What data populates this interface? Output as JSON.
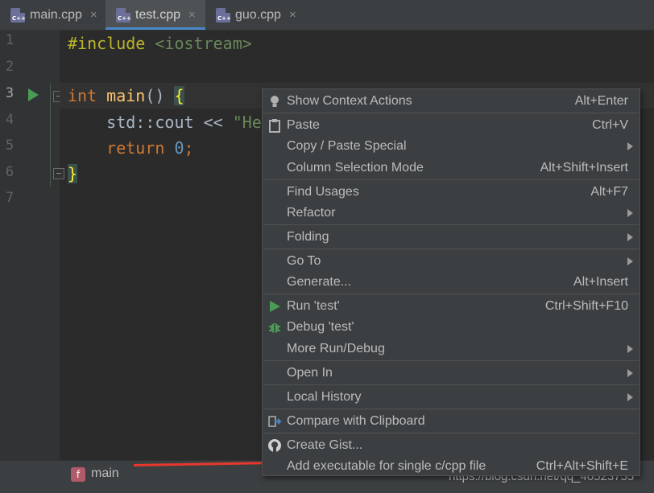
{
  "tabs": [
    {
      "label": "main.cpp",
      "close": "×",
      "icon": "cpp-file-icon"
    },
    {
      "label": "test.cpp",
      "close": "×",
      "icon": "cpp-file-icon",
      "active": true
    },
    {
      "label": "guo.cpp",
      "close": "×",
      "icon": "cpp-file-icon"
    }
  ],
  "file_icon_text": "C++",
  "line_numbers": [
    "1",
    "2",
    "3",
    "4",
    "5",
    "6",
    "7"
  ],
  "current_line": "3",
  "code": {
    "l1_directive": "#include",
    "l1_header": "<iostream>",
    "l3_type": "int",
    "l3_fn": "main",
    "l3_parens": "()",
    "l3_brace": "{",
    "l4_indent": "    ",
    "l4_ns": "std::cout",
    "l4_op": " << ",
    "l4_str": "\"He",
    "l5_kw": "return",
    "l5_num": "0",
    "l5_semi": ";",
    "l6_brace": "}"
  },
  "context_menu": {
    "items": [
      {
        "label": "Show Context Actions",
        "shortcut": "Alt+Enter",
        "icon": "lightbulb-icon"
      },
      {
        "label": "Paste",
        "shortcut": "Ctrl+V",
        "icon": "clipboard-icon"
      },
      {
        "label": "Copy / Paste Special",
        "submenu": true
      },
      {
        "label": "Column Selection Mode",
        "shortcut": "Alt+Shift+Insert"
      },
      {
        "label": "Find Usages",
        "shortcut": "Alt+F7"
      },
      {
        "label": "Refactor",
        "submenu": true
      },
      {
        "label": "Folding",
        "submenu": true
      },
      {
        "label": "Go To",
        "submenu": true
      },
      {
        "label": "Generate...",
        "shortcut": "Alt+Insert"
      },
      {
        "label": "Run 'test'",
        "shortcut": "Ctrl+Shift+F10",
        "icon": "run-icon"
      },
      {
        "label": "Debug 'test'",
        "icon": "debug-bug-icon"
      },
      {
        "label": "More Run/Debug",
        "submenu": true
      },
      {
        "label": "Open In",
        "submenu": true
      },
      {
        "label": "Local History",
        "submenu": true
      },
      {
        "label": "Compare with Clipboard",
        "icon": "compare-icon"
      },
      {
        "label": "Create Gist...",
        "icon": "github-icon"
      },
      {
        "label": "Add executable for single c/cpp file",
        "shortcut": "Ctrl+Alt+Shift+E"
      }
    ]
  },
  "breadcrumb": {
    "badge": "f",
    "label": "main"
  },
  "watermark": "https://blog.csdn.net/qq_46523755",
  "colors": {
    "accent": "#4a88c7",
    "annotation_arrow": "#e8382d",
    "run_green": "#499c54"
  }
}
